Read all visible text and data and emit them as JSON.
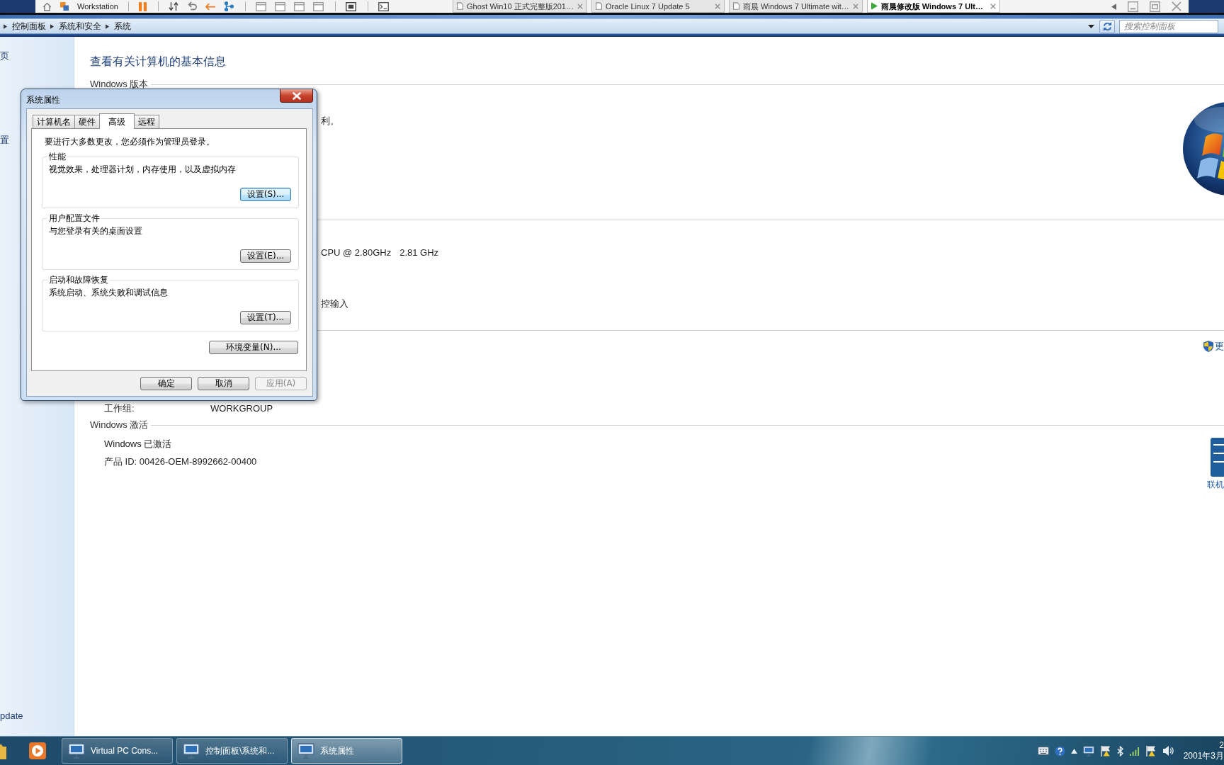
{
  "vm_toolbar": {
    "app_label": "Workstation",
    "tabs": [
      {
        "label": "Ghost Win10 正式完整版201…",
        "selected": false
      },
      {
        "label": "Oracle Linux 7 Update 5",
        "selected": false
      },
      {
        "label": "雨晨 Windows 7 Ultimate wit…",
        "selected": false
      },
      {
        "label": "雨晨修改版 Windows 7 Ult…",
        "selected": true
      }
    ]
  },
  "address_bar": {
    "breadcrumb": [
      {
        "label": "控制面板"
      },
      {
        "label": "系统和安全"
      },
      {
        "label": "系统"
      }
    ],
    "search": {
      "placeholder": "搜索控制面板"
    }
  },
  "sidebar": {
    "items": [
      {
        "label": "页"
      },
      {
        "label": "置"
      },
      {
        "label": "pdate"
      }
    ]
  },
  "main": {
    "title": "查看有关计算机的基本信息",
    "edition": {
      "heading": "Windows 版本",
      "copyright_tail": "利。"
    },
    "system": {
      "processor_tail": "CPU @ 2.80GHz",
      "processor_speed": "2.81 GHz",
      "pen_touch_tail": "控输入"
    },
    "computer_name": {
      "change_settings_link": "更",
      "workgroup_label": "工作组:",
      "workgroup_value": "WORKGROUP"
    },
    "activation": {
      "heading": "Windows 激活",
      "status": "Windows 已激活",
      "product_id": "产品 ID: 00426-OEM-8992662-00400",
      "genuine_link": "联机"
    }
  },
  "dialog": {
    "title": "系统属性",
    "tabs": [
      {
        "label": "计算机名",
        "selected": false
      },
      {
        "label": "硬件",
        "selected": false
      },
      {
        "label": "高级",
        "selected": true
      },
      {
        "label": "远程",
        "selected": false
      }
    ],
    "notice": "要进行大多数更改，您必须作为管理员登录。",
    "groups": [
      {
        "title": "性能",
        "description": "视觉效果，处理器计划，内存使用，以及虚拟内存",
        "button": {
          "label": "设置(S)...",
          "focused": true
        }
      },
      {
        "title": "用户配置文件",
        "description": "与您登录有关的桌面设置",
        "button": {
          "label": "设置(E)...",
          "focused": false
        }
      },
      {
        "title": "启动和故障恢复",
        "description": "系统启动、系统失败和调试信息",
        "button": {
          "label": "设置(T)...",
          "focused": false
        }
      }
    ],
    "environment_button": "环境变量(N)...",
    "buttons": [
      {
        "label": "确定",
        "disabled": false
      },
      {
        "label": "取消",
        "disabled": false
      },
      {
        "label": "应用(A)",
        "disabled": true
      }
    ]
  },
  "taskbar": {
    "buttons": [
      {
        "label": "Virtual PC Cons...",
        "selected": false
      },
      {
        "label": "控制面板\\系统和...",
        "selected": false
      },
      {
        "label": "系统属性",
        "selected": true
      }
    ],
    "clock": {
      "time": "2",
      "date": "2001年3月"
    }
  }
}
